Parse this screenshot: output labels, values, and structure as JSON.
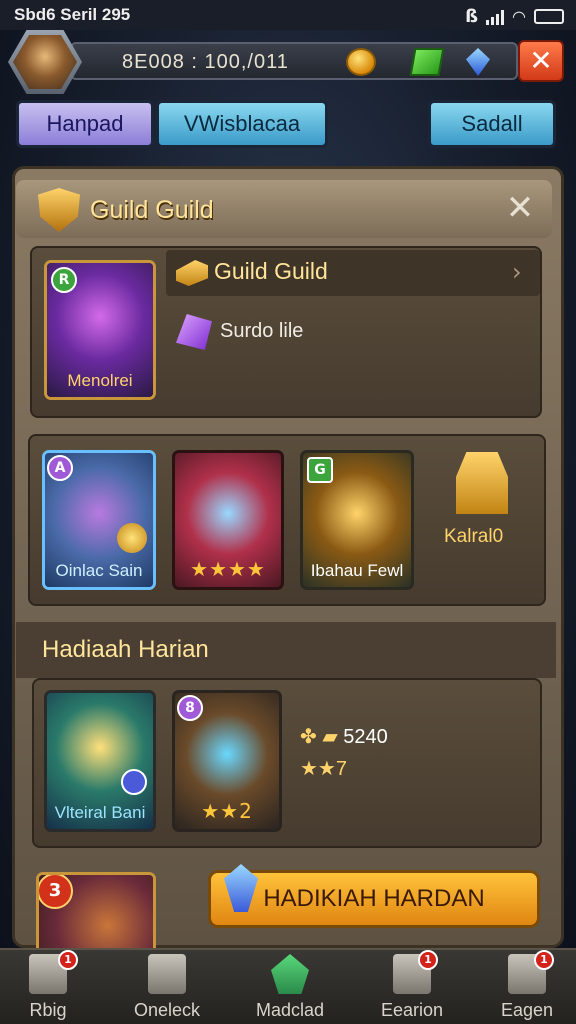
{
  "status_bar": {
    "time": "Sbd6 Seril 295"
  },
  "top_bar": {
    "resources": "8E008 : 100,/011"
  },
  "tabs": [
    {
      "label": "Hanpad"
    },
    {
      "label": "VWisblacaa"
    },
    {
      "label": "Sadall"
    }
  ],
  "panel": {
    "title": "Guild Guild",
    "featured": {
      "card_caption": "Menolrei",
      "card_badge": "R",
      "title": "Guild Guild",
      "subtitle": "Surdo lile"
    },
    "rewards_row": [
      {
        "caption": "Oinlac Sain",
        "badge": "A"
      },
      {
        "stars": "★★★★"
      },
      {
        "caption": "Ibahau Fewl",
        "badge": "G"
      },
      {
        "caption": "Kalral0"
      }
    ],
    "daily": {
      "title": "Hadiaah Harian",
      "cards": [
        {
          "caption": "Vlteiral Bani"
        },
        {
          "badge": "8",
          "stars": "★★2"
        }
      ],
      "reward_lines": [
        {
          "value": "5240"
        },
        {
          "value": "★★7"
        }
      ]
    },
    "bottom_card_badge": "3",
    "claim_button": "HADIKIAH HARDAN"
  },
  "nav": [
    {
      "label": "Rbig",
      "badge": "1"
    },
    {
      "label": "Oneleck"
    },
    {
      "label": "Madclad"
    },
    {
      "label": "Eearion",
      "badge": "1"
    },
    {
      "label": "Eagen",
      "badge": "1"
    }
  ]
}
